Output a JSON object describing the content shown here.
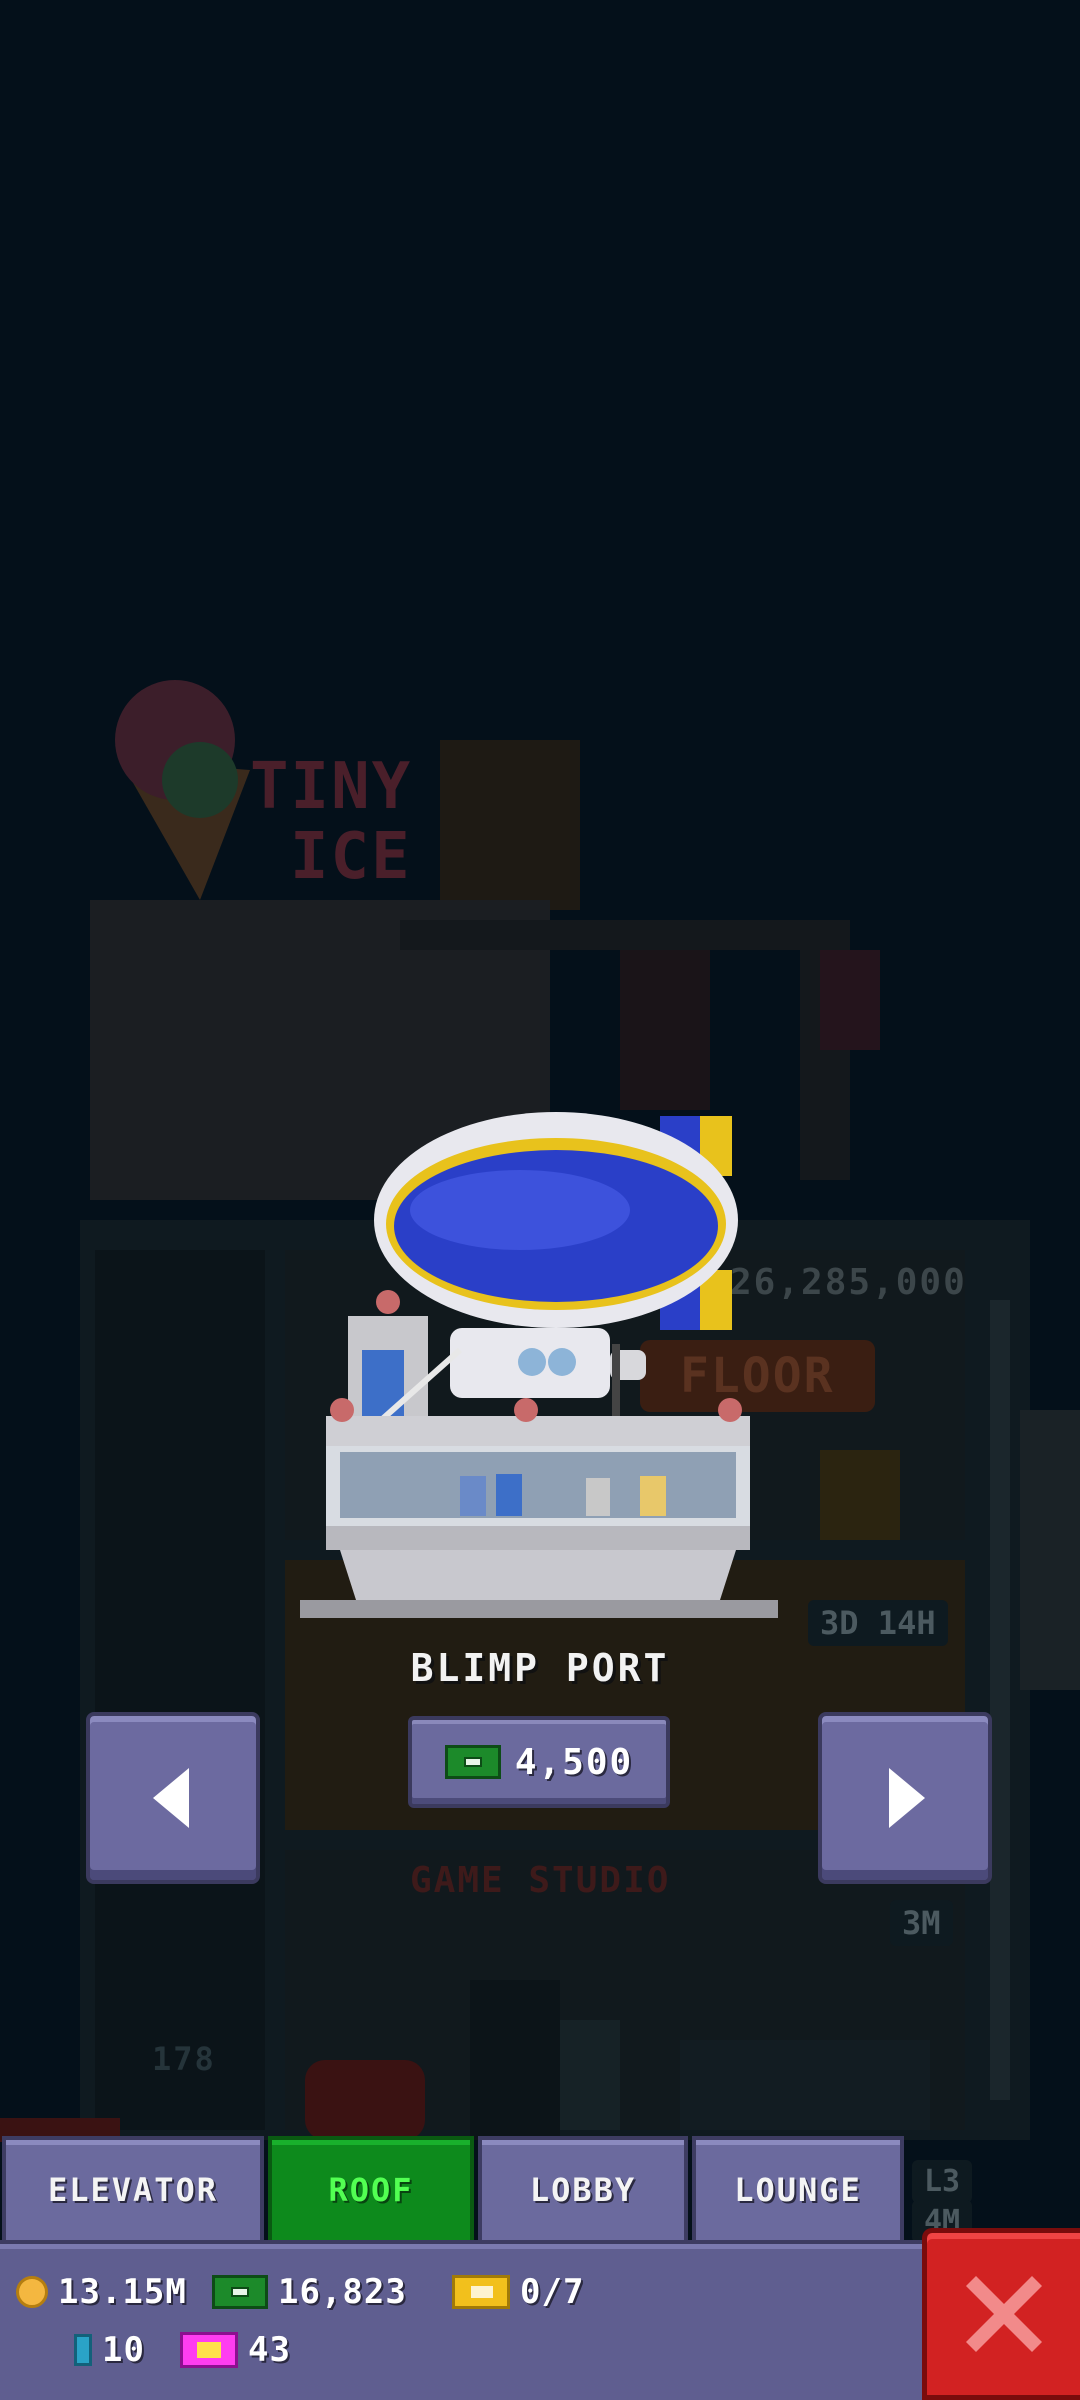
{
  "item": {
    "name": "BLIMP PORT",
    "price": "4,500",
    "currency_icon": "tower-bucks-icon"
  },
  "navigation": {
    "prev_icon": "arrow-left-icon",
    "next_icon": "arrow-right-icon"
  },
  "tabs": [
    {
      "label": "ELEVATOR",
      "active": false
    },
    {
      "label": "ROOF",
      "active": true
    },
    {
      "label": "LOBBY",
      "active": false
    },
    {
      "label": "LOUNGE",
      "active": false
    }
  ],
  "status": {
    "coins": "13.15M",
    "bux": "16,823",
    "tickets": "0/7",
    "elevator_count": "10",
    "vip_count": "43"
  },
  "background": {
    "shop_sign_line1": "TINY",
    "shop_sign_line2": "ICE",
    "price_hint": "26,285,000",
    "floor_button": "FLOOR",
    "timer_badge": "3D 14H",
    "floor_name": "GAME STUDIO",
    "floor_badge": "3M",
    "floor_number": "178",
    "right_badge1": "L3",
    "right_badge2": "4M"
  },
  "colors": {
    "panel": "#6b6a9e",
    "active_tab": "#0d8a1c",
    "close": "#d22222",
    "blimp_blue": "#2a3fc8",
    "blimp_stripe": "#e8c21c"
  }
}
